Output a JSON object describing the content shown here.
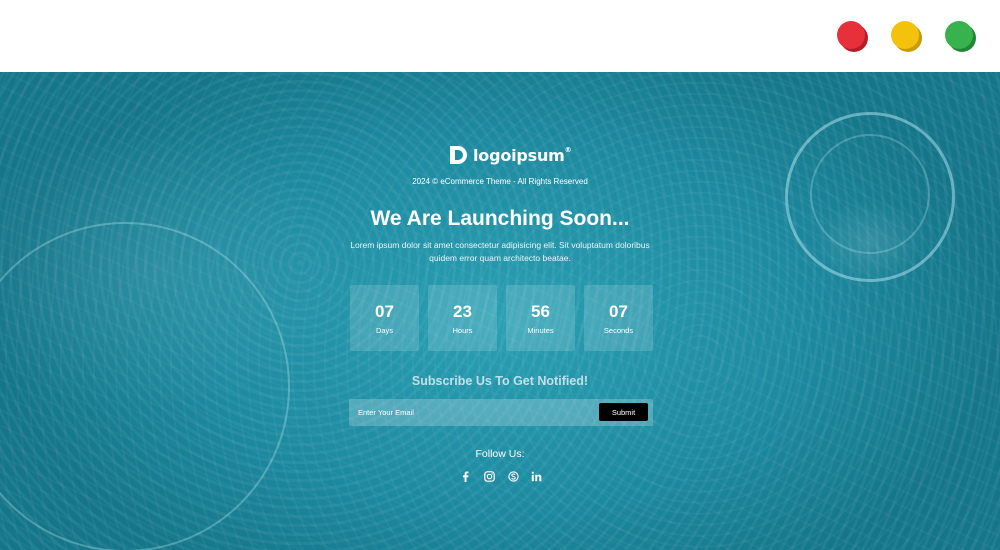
{
  "window_controls": {
    "close_color": "#e8303a",
    "minimize_color": "#f4c20d",
    "maximize_color": "#37b24d"
  },
  "brand": {
    "logo_text": "logoipsum",
    "logo_mark": "®"
  },
  "header": {
    "copyright": "2024 © eCommerce Theme - All Rights Reserved",
    "headline": "We Are Launching Soon...",
    "description": "Lorem ipsum dolor sit amet consectetur adipisicing elit. Sit voluptatum doloribus quidem error quam architecto beatae."
  },
  "countdown": [
    {
      "value": "07",
      "label": "Days"
    },
    {
      "value": "23",
      "label": "Hours"
    },
    {
      "value": "56",
      "label": "Minutes"
    },
    {
      "value": "07",
      "label": "Seconds"
    }
  ],
  "subscribe": {
    "title": "Subscribe Us To Get Notified!",
    "placeholder": "Enter Your Email",
    "submit_label": "Submit"
  },
  "social": {
    "title": "Follow Us:",
    "icons": [
      "facebook-icon",
      "instagram-icon",
      "skype-icon",
      "linkedin-icon"
    ]
  }
}
